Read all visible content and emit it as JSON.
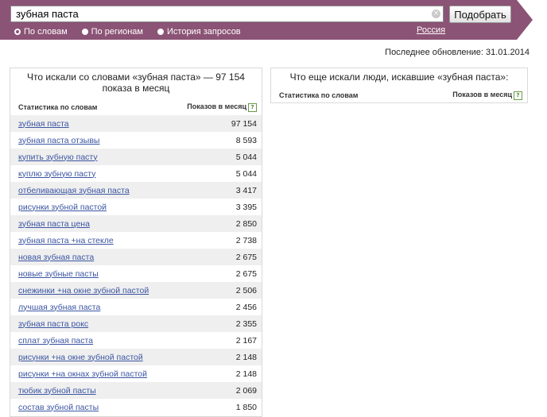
{
  "search": {
    "query": "зубная паста",
    "submit_label": "Подобрать",
    "clear_glyph": "×"
  },
  "modes": [
    {
      "label": "По словам",
      "selected": true
    },
    {
      "label": "По регионам",
      "selected": false
    },
    {
      "label": "История запросов",
      "selected": false
    }
  ],
  "region": "Россия",
  "last_updated": "Последнее обновление: 31.01.2014",
  "left_panel": {
    "title": "Что искали со словами «зубная паста» — 97 154 показа в месяц",
    "col_phrase": "Статистика по словам",
    "col_count": "Показов в месяц",
    "help_glyph": "?",
    "rows": [
      {
        "phrase": "зубная паста",
        "count": "97 154"
      },
      {
        "phrase": "зубная паста отзывы",
        "count": "8 593"
      },
      {
        "phrase": "купить зубную пасту",
        "count": "5 044"
      },
      {
        "phrase": "куплю зубную пасту",
        "count": "5 044"
      },
      {
        "phrase": "отбеливающая зубная паста",
        "count": "3 417"
      },
      {
        "phrase": "рисунки зубной пастой",
        "count": "3 395"
      },
      {
        "phrase": "зубная паста цена",
        "count": "2 850"
      },
      {
        "phrase": "зубная паста +на стекле",
        "count": "2 738"
      },
      {
        "phrase": "новая зубная паста",
        "count": "2 675"
      },
      {
        "phrase": "новые зубные пасты",
        "count": "2 675"
      },
      {
        "phrase": "снежинки +на окне зубной пастой",
        "count": "2 506"
      },
      {
        "phrase": "лучшая зубная паста",
        "count": "2 456"
      },
      {
        "phrase": "зубная паста рокс",
        "count": "2 355"
      },
      {
        "phrase": "сплат зубная паста",
        "count": "2 167"
      },
      {
        "phrase": "рисунки +на окне зубной пастой",
        "count": "2 148"
      },
      {
        "phrase": "рисунки +на окнах зубной пастой",
        "count": "2 148"
      },
      {
        "phrase": "тюбик зубной пасты",
        "count": "2 069"
      },
      {
        "phrase": "состав зубной пасты",
        "count": "1 850"
      }
    ]
  },
  "right_panel": {
    "title": "Что еще искали люди, искавшие «зубная паста»:",
    "col_phrase": "Статистика по словам",
    "col_count": "Показов в месяц",
    "help_glyph": "?"
  },
  "colors": {
    "band": "#8b5375",
    "link": "#3b55a2",
    "row_stripe": "#efefef"
  }
}
